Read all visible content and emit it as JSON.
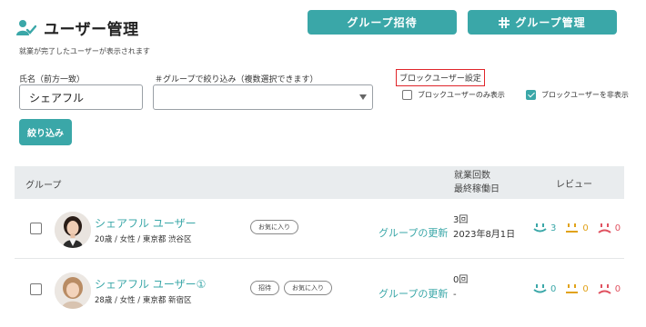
{
  "header": {
    "title": "ユーザー管理",
    "subtitle": "就業が完了したユーザーが表示されます",
    "invite_button": "グループ招待",
    "manage_button": "グループ管理"
  },
  "filters": {
    "name_label": "氏名（前方一致）",
    "name_value": "シェアフル",
    "group_label": "＃グループで絞り込み（複数選択できます）",
    "group_value": "",
    "block_label": "ブロックユーザー設定",
    "block_only_label": "ブロックユーザーのみ表示",
    "block_only_checked": false,
    "block_hide_label": "ブロックユーザーを非表示",
    "block_hide_checked": true,
    "filter_button": "絞り込み"
  },
  "table": {
    "col_group": "グループ",
    "col_work_line1": "就業回数",
    "col_work_line2": "最終稼働日",
    "col_review": "レビュー",
    "rows": [
      {
        "name": "シェアフル ユーザー",
        "info": "20歳 / 女性 / 東京都 渋谷区",
        "tags": [
          "お気に入り"
        ],
        "update_link": "グループの更新",
        "work_count": "3回",
        "last_date": "2023年8月1日",
        "review_good": "3",
        "review_neutral": "0",
        "review_bad": "0"
      },
      {
        "name": "シェアフル ユーザー①",
        "info": "28歳 / 女性 / 東京都 新宿区",
        "tags": [
          "招待",
          "お気に入り"
        ],
        "update_link": "グループの更新",
        "work_count": "0回",
        "last_date": "-",
        "review_good": "0",
        "review_neutral": "0",
        "review_bad": "0"
      }
    ]
  },
  "colors": {
    "accent": "#3aa7a8",
    "review_good": "#3aa7a8",
    "review_neutral": "#e1a219",
    "review_bad": "#e05260",
    "highlight_border": "#e0252a"
  }
}
